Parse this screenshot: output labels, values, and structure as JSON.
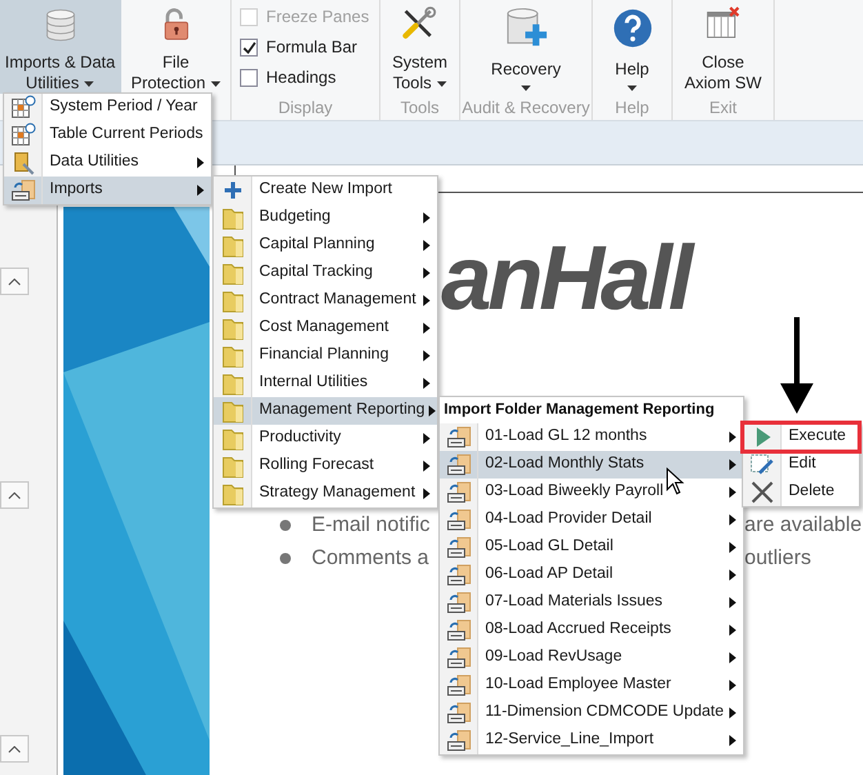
{
  "ribbon": {
    "groups": [
      {
        "items": [
          {
            "kind": "button",
            "lines": [
              "Imports & Data",
              "Utilities"
            ],
            "dropdown": true,
            "selected": true
          }
        ]
      },
      {
        "items": [
          {
            "kind": "button",
            "lines": [
              "File",
              "Protection"
            ],
            "dropdown": true,
            "selected": false
          }
        ]
      },
      {
        "label": "Display",
        "items": [
          {
            "kind": "checkbox",
            "label": "Freeze Panes",
            "checked": false,
            "disabled": true
          },
          {
            "kind": "checkbox",
            "label": "Formula Bar",
            "checked": true,
            "disabled": false
          },
          {
            "kind": "checkbox",
            "label": "Headings",
            "checked": false,
            "disabled": false
          }
        ]
      },
      {
        "label": "Tools",
        "items": [
          {
            "kind": "button",
            "lines": [
              "System",
              "Tools"
            ],
            "dropdown": true,
            "selected": false
          }
        ]
      },
      {
        "label": "Audit & Recovery",
        "items": [
          {
            "kind": "button",
            "lines": [
              "Recovery"
            ],
            "dropdown": true,
            "selected": false
          }
        ]
      },
      {
        "label": "Help",
        "items": [
          {
            "kind": "button",
            "lines": [
              "Help"
            ],
            "dropdown": true,
            "selected": false
          }
        ]
      },
      {
        "label": "Exit",
        "items": [
          {
            "kind": "button",
            "lines": [
              "Close",
              "Axiom SW"
            ],
            "dropdown": false,
            "selected": false
          }
        ]
      }
    ]
  },
  "document": {
    "logo": "anHall",
    "bullets": [
      {
        "left": "E-mail notific",
        "right": "are available"
      },
      {
        "left": "Comments a",
        "right": "outliers"
      }
    ]
  },
  "menus": [
    {
      "items": [
        {
          "kind": "period",
          "label": "System Period / Year",
          "has_submenu": false,
          "selected": false
        },
        {
          "kind": "period",
          "label": "Table Current Periods",
          "has_submenu": false,
          "selected": false
        },
        {
          "kind": "utility",
          "label": "Data Utilities",
          "has_submenu": true,
          "selected": false
        },
        {
          "kind": "import",
          "label": "Imports",
          "has_submenu": true,
          "selected": true
        }
      ]
    },
    {
      "items": [
        {
          "kind": "add",
          "label": "Create New Import",
          "has_submenu": false,
          "selected": false
        },
        {
          "kind": "folder",
          "label": "Budgeting",
          "has_submenu": true,
          "selected": false
        },
        {
          "kind": "folder",
          "label": "Capital Planning",
          "has_submenu": true,
          "selected": false
        },
        {
          "kind": "folder",
          "label": "Capital Tracking",
          "has_submenu": true,
          "selected": false
        },
        {
          "kind": "folder",
          "label": "Contract Management",
          "has_submenu": true,
          "selected": false
        },
        {
          "kind": "folder",
          "label": "Cost Management",
          "has_submenu": true,
          "selected": false
        },
        {
          "kind": "folder",
          "label": "Financial Planning",
          "has_submenu": true,
          "selected": false
        },
        {
          "kind": "folder",
          "label": "Internal Utilities",
          "has_submenu": true,
          "selected": false
        },
        {
          "kind": "folder",
          "label": "Management Reporting",
          "has_submenu": true,
          "selected": true
        },
        {
          "kind": "folder",
          "label": "Productivity",
          "has_submenu": true,
          "selected": false
        },
        {
          "kind": "folder",
          "label": "Rolling Forecast",
          "has_submenu": true,
          "selected": false
        },
        {
          "kind": "folder",
          "label": "Strategy Management",
          "has_submenu": true,
          "selected": false
        }
      ]
    },
    {
      "header": "Import Folder Management Reporting",
      "items": [
        {
          "kind": "import",
          "label": "01-Load GL 12 months",
          "has_submenu": true,
          "selected": false
        },
        {
          "kind": "import",
          "label": "02-Load Monthly Stats",
          "has_submenu": true,
          "selected": true
        },
        {
          "kind": "import",
          "label": "03-Load Biweekly Payroll",
          "has_submenu": true,
          "selected": false
        },
        {
          "kind": "import",
          "label": "04-Load Provider Detail",
          "has_submenu": true,
          "selected": false
        },
        {
          "kind": "import",
          "label": "05-Load GL Detail",
          "has_submenu": true,
          "selected": false
        },
        {
          "kind": "import",
          "label": "06-Load AP Detail",
          "has_submenu": true,
          "selected": false
        },
        {
          "kind": "import",
          "label": "07-Load Materials Issues",
          "has_submenu": true,
          "selected": false
        },
        {
          "kind": "import",
          "label": "08-Load Accrued Receipts",
          "has_submenu": true,
          "selected": false
        },
        {
          "kind": "import",
          "label": "09-Load RevUsage",
          "has_submenu": true,
          "selected": false
        },
        {
          "kind": "import",
          "label": "10-Load Employee Master",
          "has_submenu": true,
          "selected": false
        },
        {
          "kind": "import",
          "label": "11-Dimension CDMCODE Update",
          "has_submenu": true,
          "selected": false
        },
        {
          "kind": "import",
          "label": "12-Service_Line_Import",
          "has_submenu": true,
          "selected": false
        }
      ]
    },
    {
      "items": [
        {
          "kind": "execute",
          "label": "Execute",
          "has_submenu": false,
          "selected": false,
          "framed": true
        },
        {
          "kind": "edit",
          "label": "Edit",
          "has_submenu": false,
          "selected": false,
          "framed": false
        },
        {
          "kind": "delete",
          "label": "Delete",
          "has_submenu": false,
          "selected": false,
          "framed": false
        }
      ]
    }
  ]
}
